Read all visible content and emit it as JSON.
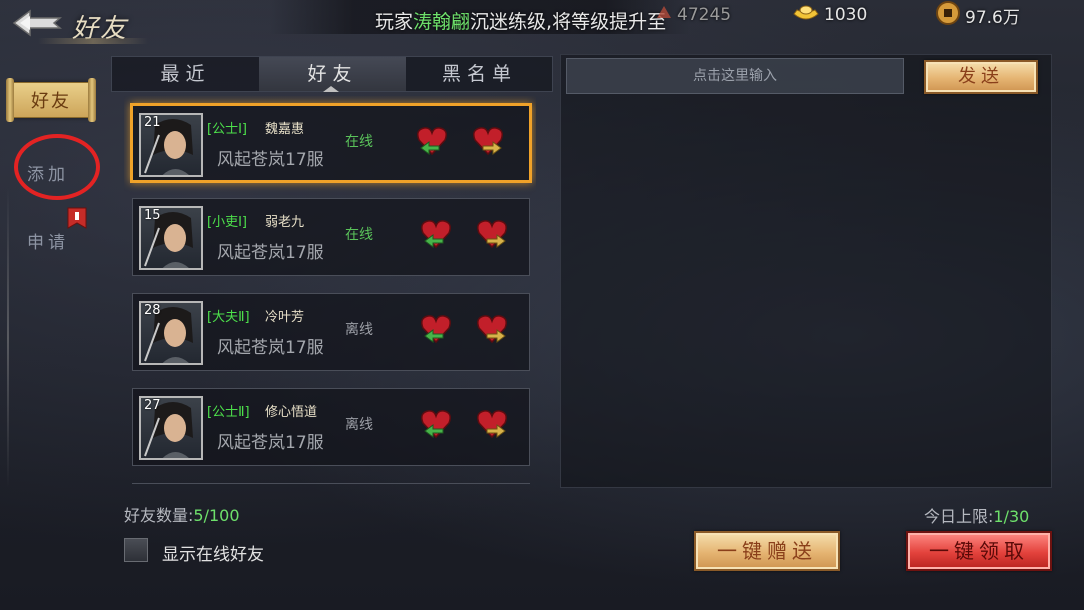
{
  "header": {
    "title": "好友",
    "marquee_prefix": "玩家",
    "marquee_name": "涛翰翩",
    "marquee_suffix": "沉迷练级,将等级提升至",
    "power": "47245",
    "ingot": "1030",
    "coins": "97.6万"
  },
  "sidebar": {
    "tabs": [
      {
        "label": "好友",
        "active": true
      },
      {
        "label": "添加",
        "active": false
      },
      {
        "label": "申请",
        "active": false
      }
    ]
  },
  "tabs": [
    {
      "label": "最近",
      "active": false
    },
    {
      "label": "好友",
      "active": true
    },
    {
      "label": "黑名单",
      "active": false
    }
  ],
  "friends": [
    {
      "level": "21",
      "title": "[公士Ⅰ]",
      "name": "魏嘉惠",
      "server": "风起苍岚17服",
      "status": "在线",
      "online": true
    },
    {
      "level": "15",
      "title": "[小吏Ⅰ]",
      "name": "弱老九",
      "server": "风起苍岚17服",
      "status": "在线",
      "online": true
    },
    {
      "level": "28",
      "title": "[大夫Ⅱ]",
      "name": "冷叶芳",
      "server": "风起苍岚17服",
      "status": "离线",
      "online": false
    },
    {
      "level": "27",
      "title": "[公士Ⅱ]",
      "name": "修心悟道",
      "server": "风起苍岚17服",
      "status": "离线",
      "online": false
    }
  ],
  "chat": {
    "placeholder": "点击这里输入",
    "send_label": "发送"
  },
  "footer": {
    "friend_count_label": "好友数量:",
    "friend_count_value": "5/100",
    "show_online_label": "显示在线好友",
    "daily_limit_label": "今日上限:",
    "daily_limit_value": "1/30",
    "gift_all_label": "一键赠送",
    "claim_all_label": "一键领取"
  },
  "colors": {
    "online": "#5ac25a",
    "highlight": "#6ee06b",
    "selected_border": "#f0a229",
    "annotation_circle": "#e32323"
  }
}
